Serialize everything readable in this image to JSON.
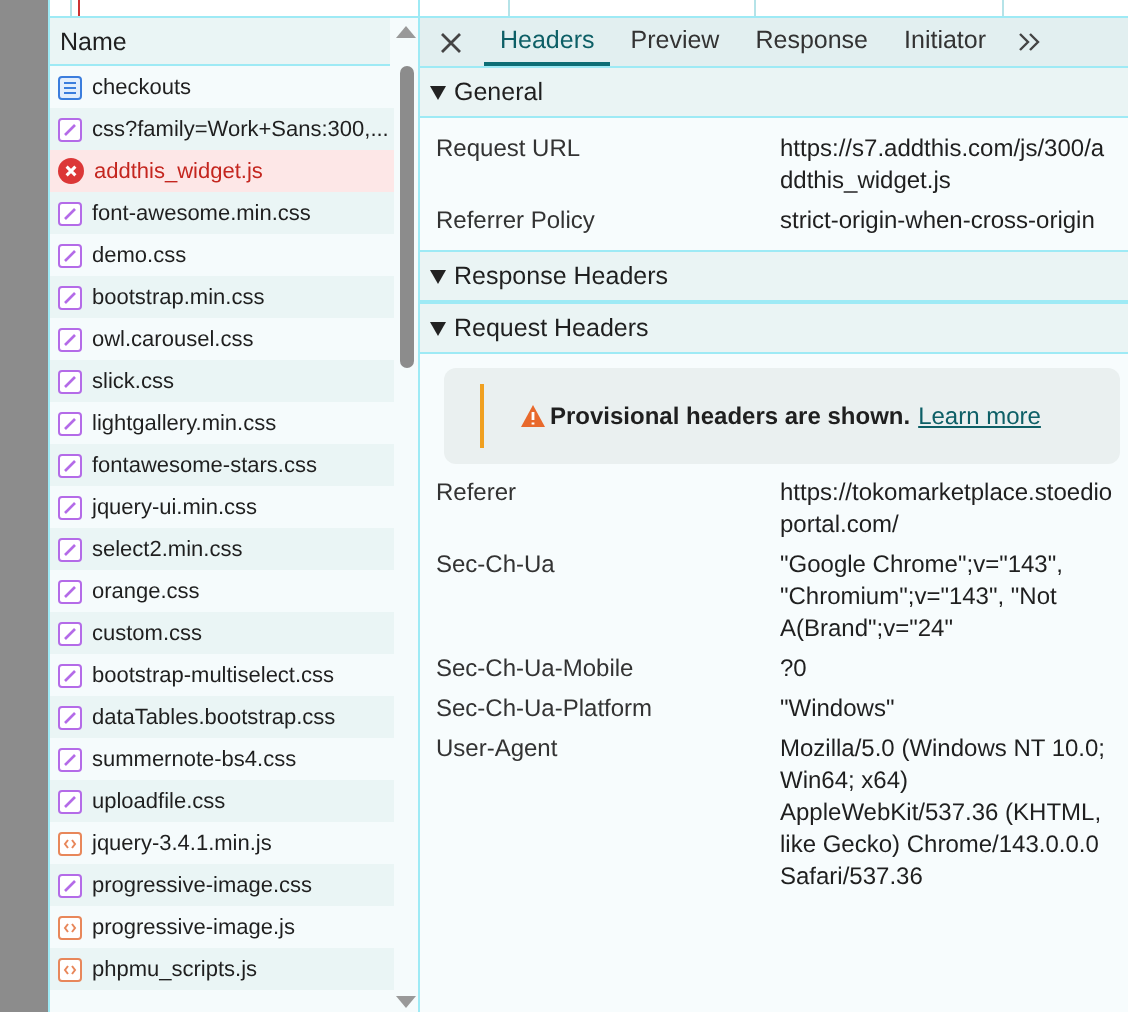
{
  "requests": {
    "column": "Name",
    "rows": [
      {
        "name": "checkouts",
        "kind": "document"
      },
      {
        "name": "css?family=Work+Sans:300,...",
        "kind": "stylesheet"
      },
      {
        "name": "addthis_widget.js",
        "kind": "error"
      },
      {
        "name": "font-awesome.min.css",
        "kind": "stylesheet"
      },
      {
        "name": "demo.css",
        "kind": "stylesheet"
      },
      {
        "name": "bootstrap.min.css",
        "kind": "stylesheet"
      },
      {
        "name": "owl.carousel.css",
        "kind": "stylesheet"
      },
      {
        "name": "slick.css",
        "kind": "stylesheet"
      },
      {
        "name": "lightgallery.min.css",
        "kind": "stylesheet"
      },
      {
        "name": "fontawesome-stars.css",
        "kind": "stylesheet"
      },
      {
        "name": "jquery-ui.min.css",
        "kind": "stylesheet"
      },
      {
        "name": "select2.min.css",
        "kind": "stylesheet"
      },
      {
        "name": "orange.css",
        "kind": "stylesheet"
      },
      {
        "name": "custom.css",
        "kind": "stylesheet"
      },
      {
        "name": "bootstrap-multiselect.css",
        "kind": "stylesheet"
      },
      {
        "name": "dataTables.bootstrap.css",
        "kind": "stylesheet"
      },
      {
        "name": "summernote-bs4.css",
        "kind": "stylesheet"
      },
      {
        "name": "uploadfile.css",
        "kind": "stylesheet"
      },
      {
        "name": "jquery-3.4.1.min.js",
        "kind": "script"
      },
      {
        "name": "progressive-image.css",
        "kind": "stylesheet"
      },
      {
        "name": "progressive-image.js",
        "kind": "script"
      },
      {
        "name": "phpmu_scripts.js",
        "kind": "script"
      }
    ]
  },
  "details": {
    "tabs": [
      {
        "label": "Headers",
        "selected": true
      },
      {
        "label": "Preview",
        "selected": false
      },
      {
        "label": "Response",
        "selected": false
      },
      {
        "label": "Initiator",
        "selected": false
      }
    ],
    "sections": [
      {
        "title": "General",
        "expanded": true,
        "fields": [
          {
            "name": "Request URL",
            "value": "https://s7.addthis.com/js/300/addthis_widget.js"
          },
          {
            "name": "Referrer Policy",
            "value": "strict-origin-when-cross-origin"
          }
        ]
      },
      {
        "title": "Response Headers",
        "expanded": true
      },
      {
        "title": "Request Headers",
        "expanded": true,
        "notice": {
          "text": "Provisional headers are shown.",
          "link": "Learn more"
        },
        "fields": [
          {
            "name": "Referer",
            "value": "https://tokomarketplace.stoedioportal.com/"
          },
          {
            "name": "Sec-Ch-Ua",
            "value": "\"Google Chrome\";v=\"143\", \"Chromium\";v=\"143\", \"Not A(Brand\";v=\"24\""
          },
          {
            "name": "Sec-Ch-Ua-Mobile",
            "value": "?0"
          },
          {
            "name": "Sec-Ch-Ua-Platform",
            "value": "\"Windows\""
          },
          {
            "name": "User-Agent",
            "value": "Mozilla/5.0 (Windows NT 10.0; Win64; x64) AppleWebKit/537.36 (KHTML, like Gecko) Chrome/143.0.0.0 Safari/537.36"
          }
        ]
      }
    ]
  }
}
